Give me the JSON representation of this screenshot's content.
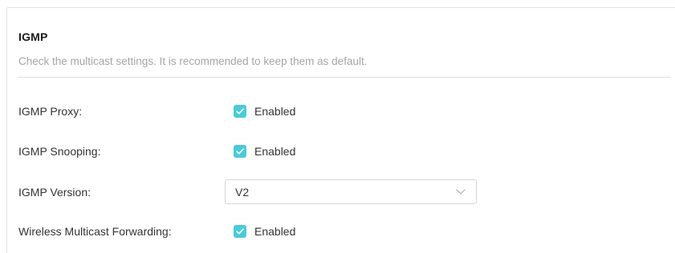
{
  "section": {
    "title": "IGMP",
    "description": "Check the multicast settings. It is recommended to keep them as default."
  },
  "settings": {
    "igmp_proxy": {
      "label": "IGMP Proxy:",
      "checkbox_label": "Enabled",
      "checked": true
    },
    "igmp_snooping": {
      "label": "IGMP Snooping:",
      "checkbox_label": "Enabled",
      "checked": true
    },
    "igmp_version": {
      "label": "IGMP Version:",
      "selected": "V2"
    },
    "wireless_multicast_forwarding": {
      "label": "Wireless Multicast Forwarding:",
      "checkbox_label": "Enabled",
      "checked": true
    }
  },
  "colors": {
    "accent": "#4acbd6",
    "title": "#1a1a1a",
    "description": "#a5a5a5",
    "label": "#333333"
  },
  "icons": {
    "checkmark": "check-icon",
    "dropdown": "chevron-down-icon"
  }
}
